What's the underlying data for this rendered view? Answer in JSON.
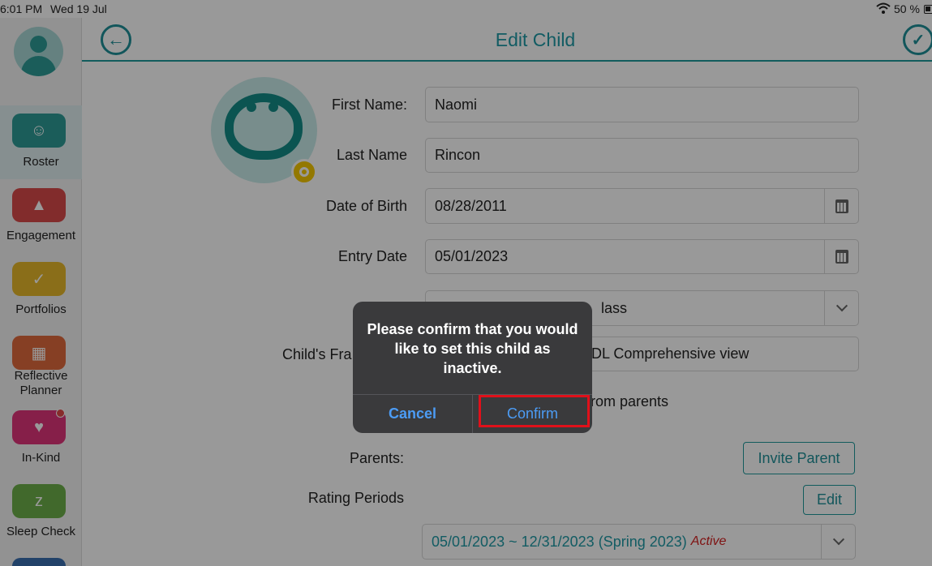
{
  "status_bar": {
    "time": "6:01 PM",
    "date": "Wed 19 Jul",
    "battery": "50 %"
  },
  "sidebar": {
    "items": [
      {
        "label": "Roster",
        "color": "#2e9c97",
        "icon": "person-icon"
      },
      {
        "label": "Engagement",
        "color": "#d94a4a",
        "icon": "engagement-icon"
      },
      {
        "label": "Portfolios",
        "color": "#e7b82a",
        "icon": "portfolio-icon"
      },
      {
        "label": "Reflective Planner",
        "color": "#e06a3c",
        "icon": "planner-icon"
      },
      {
        "label": "In-Kind",
        "color": "#e0357a",
        "icon": "heart-icon"
      },
      {
        "label": "Sleep Check",
        "color": "#6db04a",
        "icon": "sleep-icon"
      }
    ]
  },
  "header": {
    "title": "Edit Child"
  },
  "form": {
    "first_name_label": "First Name:",
    "first_name_value": "Naomi",
    "last_name_label": "Last Name",
    "last_name_value": "Rincon",
    "dob_label": "Date of Birth",
    "dob_value": "08/28/2011",
    "entry_label": "Entry Date",
    "entry_value": "05/01/2023",
    "class_value_partial": "lass",
    "framework_label_partial": "Child's Fra",
    "framework_value_partial": "DL Comprehensive view",
    "parents_row_partial": "rom parents",
    "parents_label": "Parents:",
    "invite_parent_label": "Invite Parent",
    "rating_periods_label": "Rating Periods",
    "edit_label": "Edit",
    "rating_period_value": "05/01/2023 ~ 12/31/2023 (Spring 2023)",
    "rating_period_status": "Active"
  },
  "alert": {
    "message": "Please confirm that you would like to set this child as inactive.",
    "cancel_label": "Cancel",
    "confirm_label": "Confirm"
  }
}
